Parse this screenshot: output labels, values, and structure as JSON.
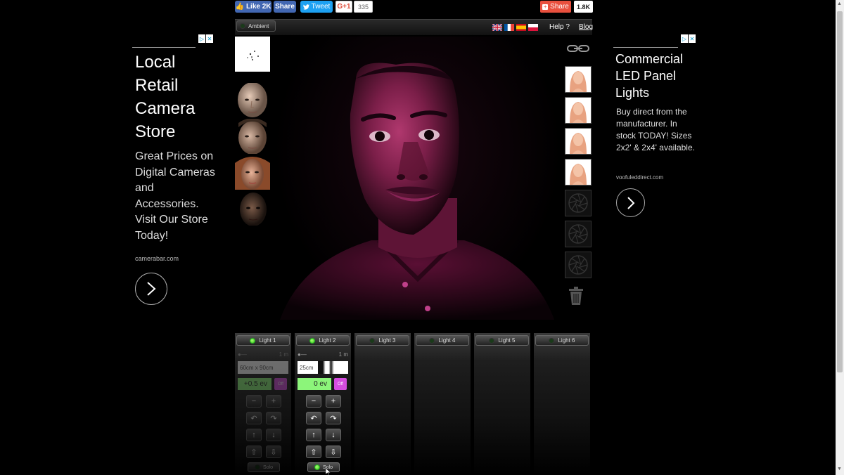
{
  "social": {
    "like_label": "Like 2K",
    "fb_share_label": "Share",
    "tweet_label": "Tweet",
    "gplus_label": "G+1",
    "gplus_count": "335",
    "share_label": "Share",
    "share_count": "1.8K"
  },
  "toolbar": {
    "ambient_label": "Ambient",
    "help_label": "Help ?",
    "blog_label": "Blog",
    "flags": [
      "uk-flag",
      "france-flag",
      "spain-flag",
      "poland-flag"
    ]
  },
  "lights": [
    {
      "label": "Light 1",
      "active": true,
      "dimmed": true,
      "distance": "1 m",
      "size": "60cm x 90cm",
      "ev": "+0.5 ev",
      "off_label": "Off",
      "solo_label": "Solo"
    },
    {
      "label": "Light 2",
      "active": true,
      "dimmed": false,
      "distance": "1 m",
      "size": "25cm",
      "ev": "0 ev",
      "off_label": "Off",
      "solo_label": "Solo"
    },
    {
      "label": "Light 3",
      "active": false
    },
    {
      "label": "Light 4",
      "active": false
    },
    {
      "label": "Light 5",
      "active": false
    },
    {
      "label": "Light 6",
      "active": false
    }
  ],
  "ads": {
    "left": {
      "title": "Local Retail Camera Store",
      "body": "Great Prices on Digital Cameras and Accessories. Visit Our Store Today!",
      "url": "camerabar.com"
    },
    "right": {
      "title": "Commercial LED Panel Lights",
      "body": "Buy direct from the manufacturer. In stock TODAY! Sizes 2x2' & 2x4' available.",
      "url": "voofuleddirect.com"
    }
  },
  "colors": {
    "ev_green": "#8cf57a",
    "off_magenta": "#d64de0",
    "led_on": "#33cc11",
    "facebook": "#4267b2",
    "twitter": "#1da1f2",
    "share_red": "#e9503e"
  }
}
